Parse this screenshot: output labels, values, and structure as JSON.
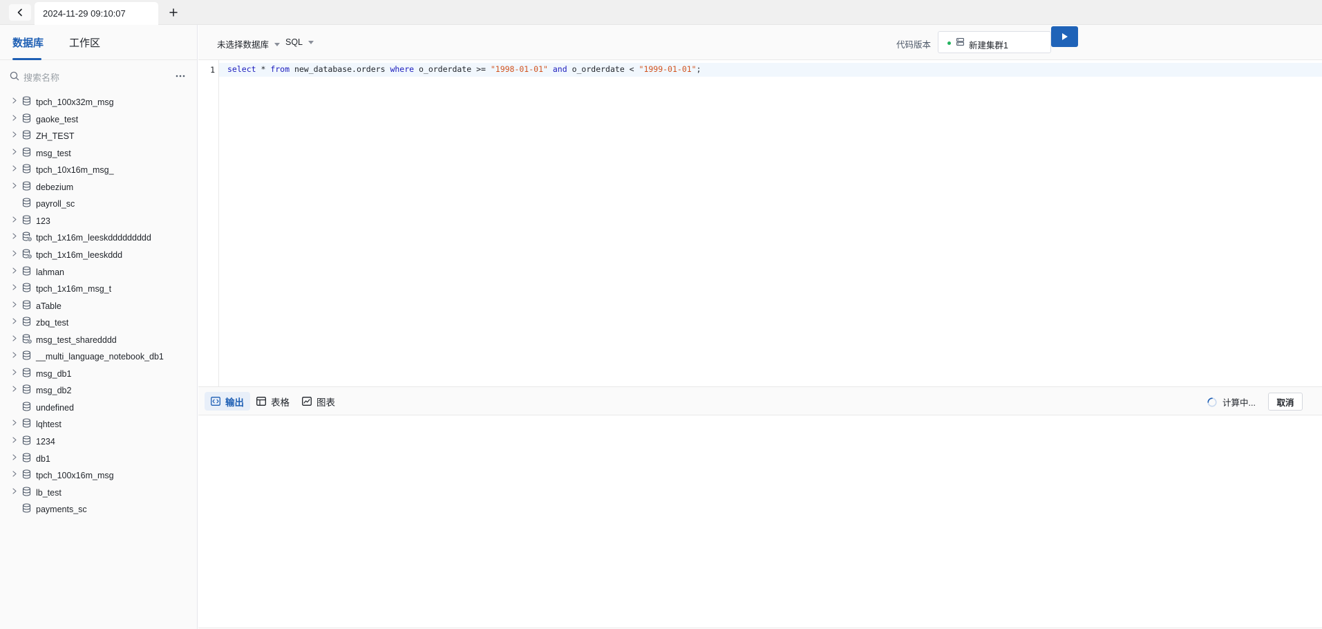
{
  "tabbar": {
    "active_tab": "2024-11-29 09:10:07",
    "back_icon": "chevron-left-icon",
    "add_icon": "plus-icon"
  },
  "sidebar": {
    "tabs": [
      "数据库",
      "工作区"
    ],
    "active_tab": "数据库",
    "search": {
      "placeholder": "搜索名称",
      "value": ""
    },
    "databases": [
      {
        "name": "tpch_100x32m_msg",
        "expandable": true,
        "shared": false
      },
      {
        "name": "gaoke_test",
        "expandable": true,
        "shared": false
      },
      {
        "name": "ZH_TEST",
        "expandable": true,
        "shared": false
      },
      {
        "name": "msg_test",
        "expandable": true,
        "shared": false
      },
      {
        "name": "tpch_10x16m_msg_",
        "expandable": true,
        "shared": false
      },
      {
        "name": "debezium",
        "expandable": true,
        "shared": false
      },
      {
        "name": "payroll_sc",
        "expandable": false,
        "shared": false
      },
      {
        "name": "123",
        "expandable": true,
        "shared": false
      },
      {
        "name": "tpch_1x16m_leeskddddddddd",
        "expandable": true,
        "shared": true
      },
      {
        "name": "tpch_1x16m_leeskddd",
        "expandable": true,
        "shared": true
      },
      {
        "name": "lahman",
        "expandable": true,
        "shared": false
      },
      {
        "name": "tpch_1x16m_msg_t",
        "expandable": true,
        "shared": false
      },
      {
        "name": "aTable",
        "expandable": true,
        "shared": false
      },
      {
        "name": "zbq_test",
        "expandable": true,
        "shared": false
      },
      {
        "name": "msg_test_sharedddd",
        "expandable": true,
        "shared": true
      },
      {
        "name": "__multi_language_notebook_db1",
        "expandable": true,
        "shared": false
      },
      {
        "name": "msg_db1",
        "expandable": true,
        "shared": false
      },
      {
        "name": "msg_db2",
        "expandable": true,
        "shared": false
      },
      {
        "name": "undefined",
        "expandable": false,
        "shared": false
      },
      {
        "name": "lqhtest",
        "expandable": true,
        "shared": false
      },
      {
        "name": "1234",
        "expandable": true,
        "shared": false
      },
      {
        "name": "db1",
        "expandable": true,
        "shared": false
      },
      {
        "name": "tpch_100x16m_msg",
        "expandable": true,
        "shared": false
      },
      {
        "name": "lb_test",
        "expandable": true,
        "shared": false
      },
      {
        "name": "payments_sc",
        "expandable": false,
        "shared": false
      }
    ]
  },
  "toolbar": {
    "database_select": "未选择数据库",
    "language_select": "SQL",
    "version_label": "代码版本",
    "cluster_name": "新建集群1",
    "cluster_status_color": "#22b35e",
    "run_icon": "play-icon",
    "accent_color": "#1f63b8"
  },
  "editor": {
    "line_number": "1",
    "code_tokens": [
      {
        "t": "select",
        "c": "kw"
      },
      {
        "t": " * ",
        "c": ""
      },
      {
        "t": "from",
        "c": "kw"
      },
      {
        "t": " new_database.orders ",
        "c": ""
      },
      {
        "t": "where",
        "c": "kw"
      },
      {
        "t": " o_orderdate >= ",
        "c": ""
      },
      {
        "t": "\"1998-01-01\"",
        "c": "str"
      },
      {
        "t": " ",
        "c": ""
      },
      {
        "t": "and",
        "c": "kw"
      },
      {
        "t": " o_orderdate < ",
        "c": ""
      },
      {
        "t": "\"1999-01-01\"",
        "c": "str"
      },
      {
        "t": ";",
        "c": ""
      }
    ]
  },
  "results": {
    "tabs": [
      {
        "label": "输出",
        "icon": "code-icon"
      },
      {
        "label": "表格",
        "icon": "table-icon"
      },
      {
        "label": "图表",
        "icon": "chart-icon"
      }
    ],
    "active_tab": "输出",
    "status": "计算中...",
    "cancel_label": "取消"
  }
}
